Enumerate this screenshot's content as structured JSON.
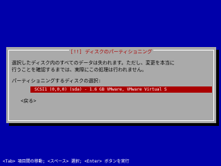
{
  "dialog": {
    "title": "[!!] ディスクのパーティショニング",
    "message_line1": "選択したディスク内のすべてのデータは失われます。ただし、変更を本当に",
    "message_line2": "行うことを確認するまでは、実際にこの処理は行われません。",
    "prompt": "パーティショニングするディスクの選択:",
    "disk_option": "SCSI1 (0,0,0) (sda) - 1.6 GB VMware, VMware Virtual S",
    "back_label": "<戻る>"
  },
  "statusbar": {
    "text": "<Tab> 項目間の移動; <スペース> 選択; <Enter> ボタンを実行"
  },
  "colors": {
    "background": "#0000aa",
    "dialog": "#aaaaaa",
    "title": "#aa0000",
    "selection": "#aa0000"
  }
}
